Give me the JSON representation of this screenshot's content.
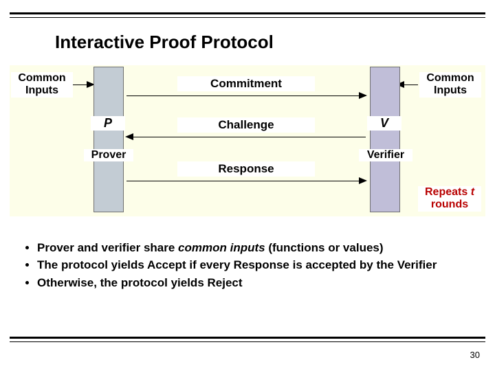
{
  "title": "Interactive Proof Protocol",
  "common_inputs_left": "Common Inputs",
  "common_inputs_right": "Common Inputs",
  "prover_symbol": "P",
  "verifier_symbol": "V",
  "prover_label": "Prover",
  "verifier_label": "Verifier",
  "messages": {
    "commitment": "Commitment",
    "challenge": "Challenge",
    "response": "Response"
  },
  "repeats_prefix": "Repeats ",
  "repeats_t": "t",
  "repeats_suffix": " rounds",
  "bullets": {
    "b1a": "Prover and verifier share ",
    "b1b": "common inputs",
    "b1c": " (functions or values)",
    "b2": "The protocol yields Accept if every Response is accepted by the Verifier",
    "b3": "Otherwise, the protocol yields Reject"
  },
  "page_number": "30"
}
